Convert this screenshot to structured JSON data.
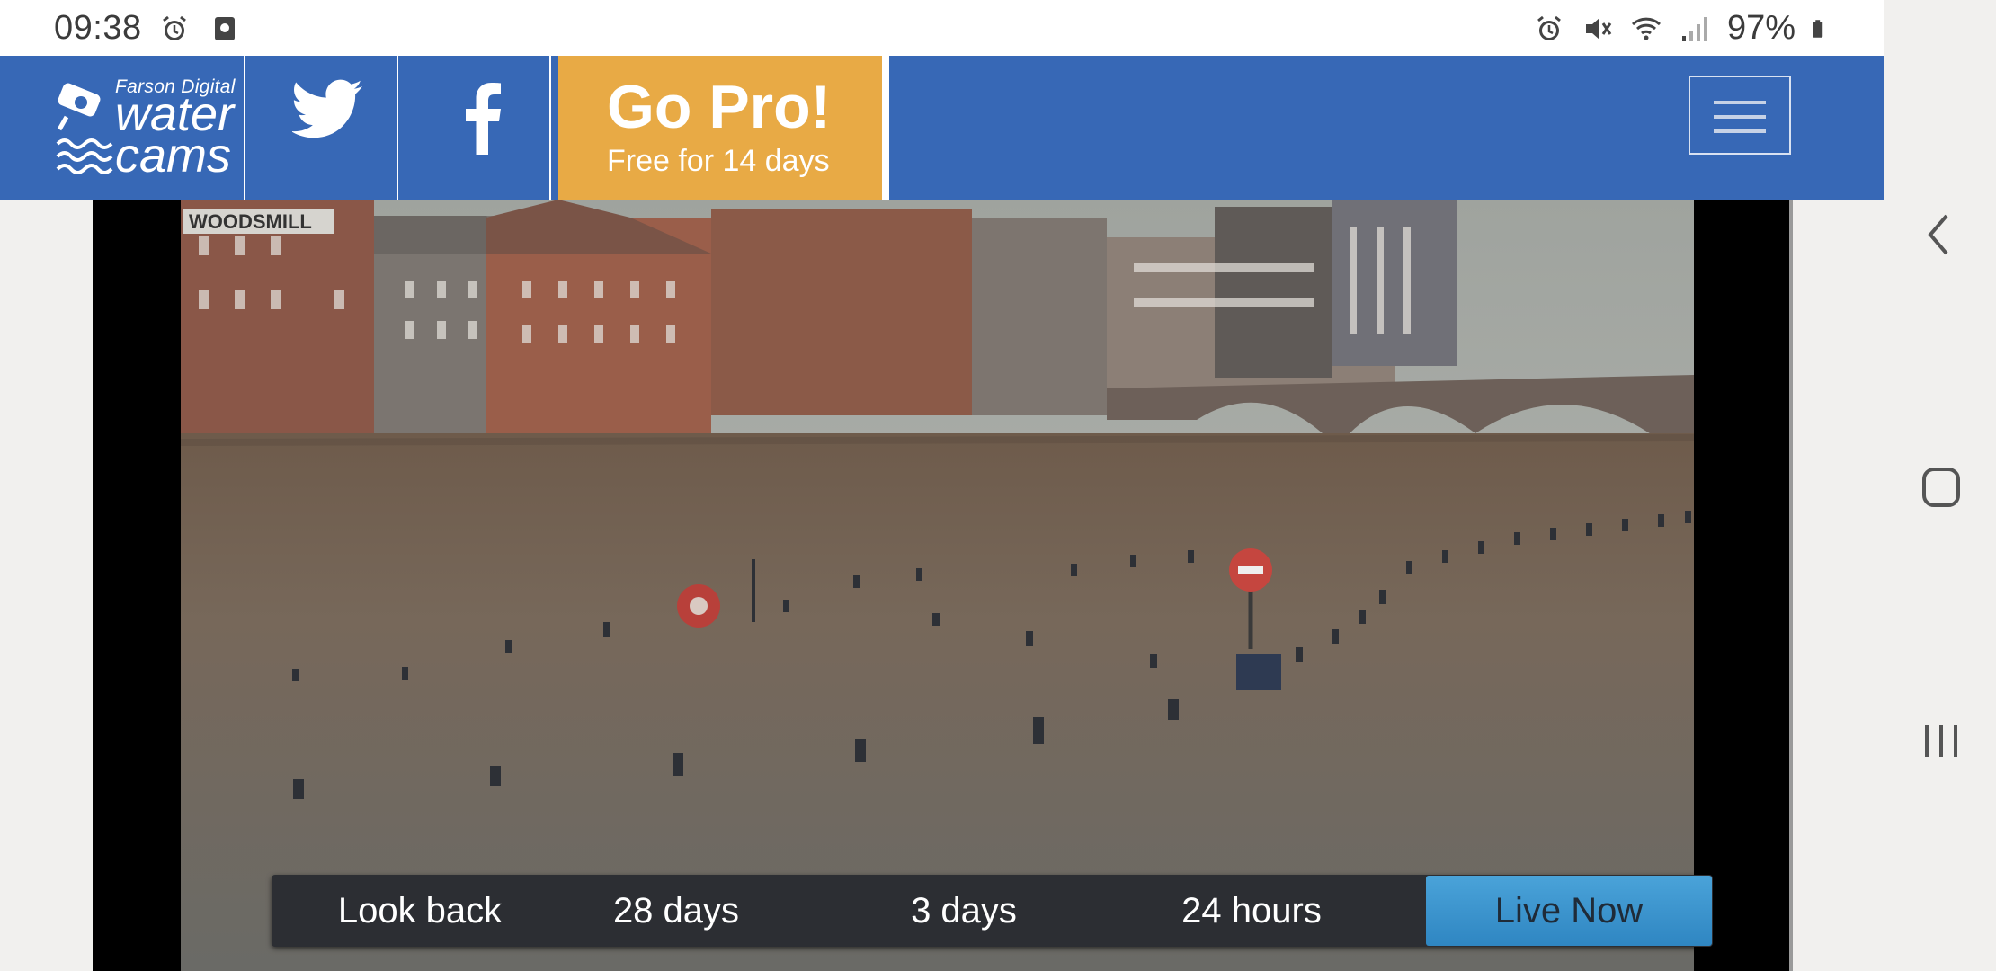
{
  "status_bar": {
    "time": "09:38",
    "left_icons": [
      "alarm-icon",
      "screenshot-icon"
    ],
    "right_icons": [
      "alarm-icon",
      "mute-icon",
      "wifi-icon",
      "signal-icon"
    ],
    "battery_percent": "97%"
  },
  "header": {
    "logo": {
      "small_text": "Farson Digital",
      "line1": "water",
      "line2": "cams"
    },
    "social": [
      "twitter-icon",
      "facebook-icon"
    ],
    "promo": {
      "title": "Go Pro!",
      "subtitle": "Free for 14 days"
    },
    "menu_icon": "hamburger-menu-icon"
  },
  "camera": {
    "sign_text": "WOODSMILL"
  },
  "timeline": {
    "label": "Look back",
    "options": [
      "28 days",
      "3 days",
      "24 hours"
    ],
    "live_label": "Live Now"
  },
  "nav": [
    "back-icon",
    "home-icon",
    "recent-apps-icon"
  ],
  "colors": {
    "header_bg": "#3768b6",
    "promo_bg": "#e8aa45",
    "live_button": "#3a95cf",
    "timeline_bg": "#2c2e33"
  }
}
